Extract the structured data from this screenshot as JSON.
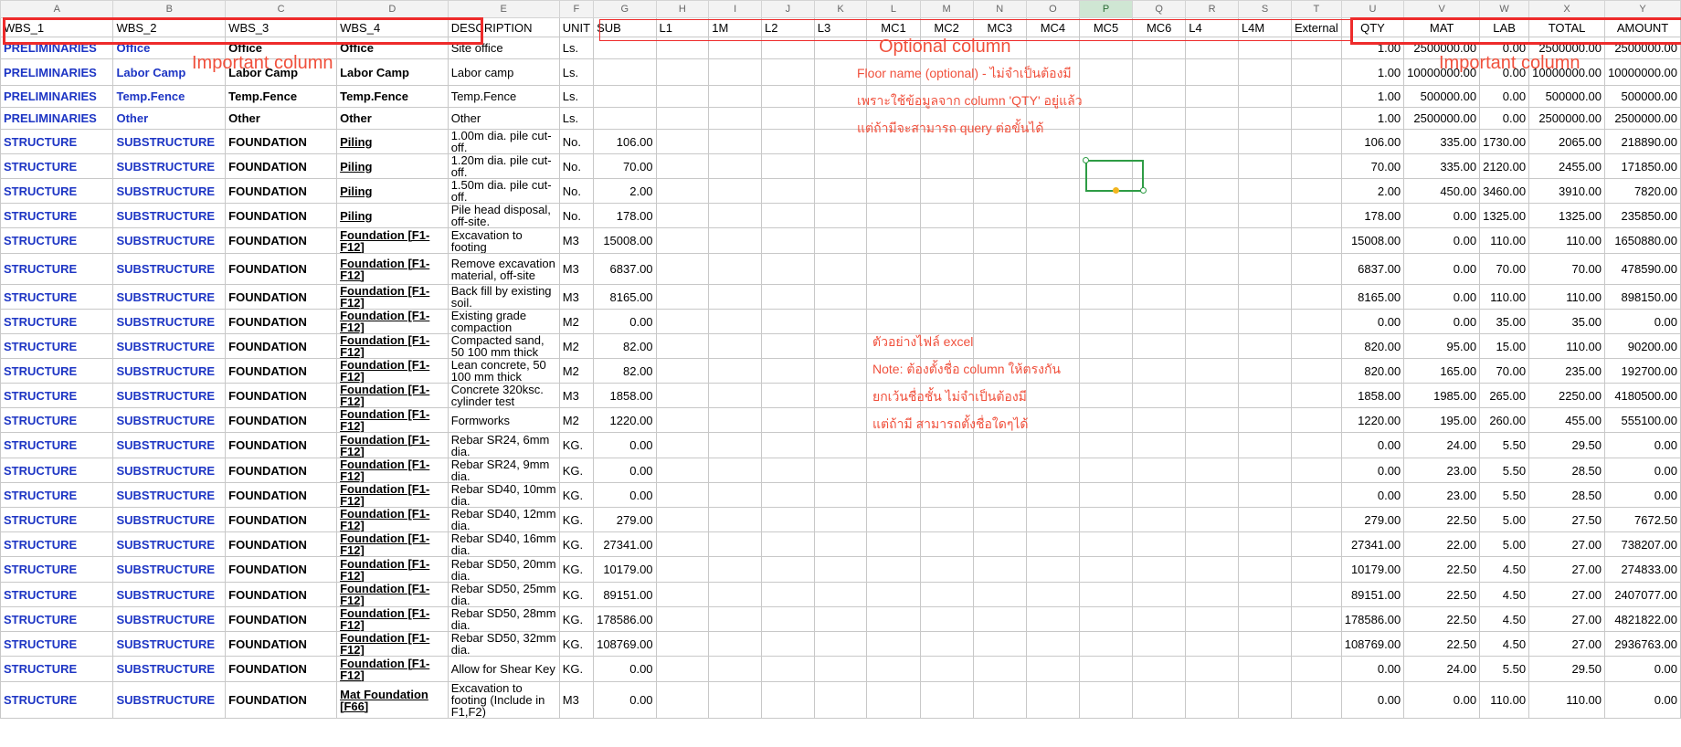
{
  "column_letters": [
    "A",
    "B",
    "C",
    "D",
    "E",
    "F",
    "G",
    "H",
    "I",
    "J",
    "K",
    "L",
    "M",
    "N",
    "O",
    "P",
    "Q",
    "R",
    "S",
    "T",
    "U",
    "V",
    "W",
    "X",
    "Y"
  ],
  "selected_column": "P",
  "header": [
    "WBS_1",
    "WBS_2",
    "WBS_3",
    "WBS_4",
    "DESCRIPTION",
    "UNIT",
    "SUB",
    "L1",
    "1M",
    "L2",
    "L3",
    "MC1",
    "MC2",
    "MC3",
    "MC4",
    "MC5",
    "MC6",
    "L4",
    "L4M",
    "External",
    "QTY",
    "MAT",
    "LAB",
    "TOTAL",
    "AMOUNT"
  ],
  "rows": [
    {
      "wbs1": "PRELIMINARIES",
      "wbs2": "Office",
      "wbs3": "Office",
      "wbs4": "Office",
      "desc": "Site office",
      "unit": "Ls.",
      "sub": "",
      "qty": "1.00",
      "mat": "2500000.00",
      "lab": "0.00",
      "total": "2500000.00",
      "amount": "2500000.00"
    },
    {
      "wbs1": "PRELIMINARIES",
      "wbs2": "Labor Camp",
      "wbs3": "Labor Camp",
      "wbs4": "Labor Camp",
      "desc": "Labor camp",
      "unit": "Ls.",
      "sub": "",
      "qty": "1.00",
      "mat": "10000000.00",
      "lab": "0.00",
      "total": "10000000.00",
      "amount": "10000000.00"
    },
    {
      "wbs1": "PRELIMINARIES",
      "wbs2": "Temp.Fence",
      "wbs3": "Temp.Fence",
      "wbs4": "Temp.Fence",
      "desc": "Temp.Fence",
      "unit": "Ls.",
      "sub": "",
      "qty": "1.00",
      "mat": "500000.00",
      "lab": "0.00",
      "total": "500000.00",
      "amount": "500000.00"
    },
    {
      "wbs1": "PRELIMINARIES",
      "wbs2": "Other",
      "wbs3": "Other",
      "wbs4": "Other",
      "desc": "Other",
      "unit": "Ls.",
      "sub": "",
      "qty": "1.00",
      "mat": "2500000.00",
      "lab": "0.00",
      "total": "2500000.00",
      "amount": "2500000.00"
    },
    {
      "wbs1": "STRUCTURE",
      "wbs2": "SUBSTRUCTURE",
      "wbs3": "FOUNDATION",
      "wbs4": "Piling",
      "desc": "1.00m dia. pile cut-off.",
      "unit": "No.",
      "sub": "106.00",
      "qty": "106.00",
      "mat": "335.00",
      "lab": "1730.00",
      "total": "2065.00",
      "amount": "218890.00"
    },
    {
      "wbs1": "STRUCTURE",
      "wbs2": "SUBSTRUCTURE",
      "wbs3": "FOUNDATION",
      "wbs4": "Piling",
      "desc": "1.20m dia. pile cut-off.",
      "unit": "No.",
      "sub": "70.00",
      "qty": "70.00",
      "mat": "335.00",
      "lab": "2120.00",
      "total": "2455.00",
      "amount": "171850.00"
    },
    {
      "wbs1": "STRUCTURE",
      "wbs2": "SUBSTRUCTURE",
      "wbs3": "FOUNDATION",
      "wbs4": "Piling",
      "desc": "1.50m dia. pile cut-off.",
      "unit": "No.",
      "sub": "2.00",
      "qty": "2.00",
      "mat": "450.00",
      "lab": "3460.00",
      "total": "3910.00",
      "amount": "7820.00"
    },
    {
      "wbs1": "STRUCTURE",
      "wbs2": "SUBSTRUCTURE",
      "wbs3": "FOUNDATION",
      "wbs4": "Piling",
      "desc": "Pile head disposal, off-site.",
      "unit": "No.",
      "sub": "178.00",
      "qty": "178.00",
      "mat": "0.00",
      "lab": "1325.00",
      "total": "1325.00",
      "amount": "235850.00"
    },
    {
      "wbs1": "STRUCTURE",
      "wbs2": "SUBSTRUCTURE",
      "wbs3": "FOUNDATION",
      "wbs4": "Foundation [F1-F12]",
      "desc": "Excavation to footing",
      "unit": "M3",
      "sub": "15008.00",
      "qty": "15008.00",
      "mat": "0.00",
      "lab": "110.00",
      "total": "110.00",
      "amount": "1650880.00"
    },
    {
      "wbs1": "STRUCTURE",
      "wbs2": "SUBSTRUCTURE",
      "wbs3": "FOUNDATION",
      "wbs4": "Foundation [F1-F12]",
      "desc": "Remove excavation material, off-site",
      "unit": "M3",
      "sub": "6837.00",
      "qty": "6837.00",
      "mat": "0.00",
      "lab": "70.00",
      "total": "70.00",
      "amount": "478590.00"
    },
    {
      "wbs1": "STRUCTURE",
      "wbs2": "SUBSTRUCTURE",
      "wbs3": "FOUNDATION",
      "wbs4": "Foundation [F1-F12]",
      "desc": "Back fill by existing soil.",
      "unit": "M3",
      "sub": "8165.00",
      "qty": "8165.00",
      "mat": "0.00",
      "lab": "110.00",
      "total": "110.00",
      "amount": "898150.00"
    },
    {
      "wbs1": "STRUCTURE",
      "wbs2": "SUBSTRUCTURE",
      "wbs3": "FOUNDATION",
      "wbs4": "Foundation [F1-F12]",
      "desc": "Existing grade compaction",
      "unit": "M2",
      "sub": "0.00",
      "qty": "0.00",
      "mat": "0.00",
      "lab": "35.00",
      "total": "35.00",
      "amount": "0.00"
    },
    {
      "wbs1": "STRUCTURE",
      "wbs2": "SUBSTRUCTURE",
      "wbs3": "FOUNDATION",
      "wbs4": "Foundation [F1-F12]",
      "desc": "Compacted sand, 50 100 mm thick",
      "unit": "M2",
      "sub": "82.00",
      "qty": "820.00",
      "mat": "95.00",
      "lab": "15.00",
      "total": "110.00",
      "amount": "90200.00"
    },
    {
      "wbs1": "STRUCTURE",
      "wbs2": "SUBSTRUCTURE",
      "wbs3": "FOUNDATION",
      "wbs4": "Foundation [F1-F12]",
      "desc": "Lean concrete, 50 100 mm thick",
      "unit": "M2",
      "sub": "82.00",
      "qty": "820.00",
      "mat": "165.00",
      "lab": "70.00",
      "total": "235.00",
      "amount": "192700.00"
    },
    {
      "wbs1": "STRUCTURE",
      "wbs2": "SUBSTRUCTURE",
      "wbs3": "FOUNDATION",
      "wbs4": "Foundation [F1-F12]",
      "desc": "Concrete 320ksc. cylinder test",
      "unit": "M3",
      "sub": "1858.00",
      "qty": "1858.00",
      "mat": "1985.00",
      "lab": "265.00",
      "total": "2250.00",
      "amount": "4180500.00"
    },
    {
      "wbs1": "STRUCTURE",
      "wbs2": "SUBSTRUCTURE",
      "wbs3": "FOUNDATION",
      "wbs4": "Foundation [F1-F12]",
      "desc": "Formworks",
      "unit": "M2",
      "sub": "1220.00",
      "qty": "1220.00",
      "mat": "195.00",
      "lab": "260.00",
      "total": "455.00",
      "amount": "555100.00"
    },
    {
      "wbs1": "STRUCTURE",
      "wbs2": "SUBSTRUCTURE",
      "wbs3": "FOUNDATION",
      "wbs4": "Foundation [F1-F12]",
      "desc": "Rebar SR24, 6mm dia.",
      "unit": "KG.",
      "sub": "0.00",
      "qty": "0.00",
      "mat": "24.00",
      "lab": "5.50",
      "total": "29.50",
      "amount": "0.00"
    },
    {
      "wbs1": "STRUCTURE",
      "wbs2": "SUBSTRUCTURE",
      "wbs3": "FOUNDATION",
      "wbs4": "Foundation [F1-F12]",
      "desc": "Rebar SR24, 9mm dia.",
      "unit": "KG.",
      "sub": "0.00",
      "qty": "0.00",
      "mat": "23.00",
      "lab": "5.50",
      "total": "28.50",
      "amount": "0.00"
    },
    {
      "wbs1": "STRUCTURE",
      "wbs2": "SUBSTRUCTURE",
      "wbs3": "FOUNDATION",
      "wbs4": "Foundation [F1-F12]",
      "desc": "Rebar SD40, 10mm dia.",
      "unit": "KG.",
      "sub": "0.00",
      "qty": "0.00",
      "mat": "23.00",
      "lab": "5.50",
      "total": "28.50",
      "amount": "0.00"
    },
    {
      "wbs1": "STRUCTURE",
      "wbs2": "SUBSTRUCTURE",
      "wbs3": "FOUNDATION",
      "wbs4": "Foundation [F1-F12]",
      "desc": "Rebar SD40, 12mm dia.",
      "unit": "KG.",
      "sub": "279.00",
      "qty": "279.00",
      "mat": "22.50",
      "lab": "5.00",
      "total": "27.50",
      "amount": "7672.50"
    },
    {
      "wbs1": "STRUCTURE",
      "wbs2": "SUBSTRUCTURE",
      "wbs3": "FOUNDATION",
      "wbs4": "Foundation [F1-F12]",
      "desc": "Rebar SD40, 16mm dia.",
      "unit": "KG.",
      "sub": "27341.00",
      "qty": "27341.00",
      "mat": "22.00",
      "lab": "5.00",
      "total": "27.00",
      "amount": "738207.00"
    },
    {
      "wbs1": "STRUCTURE",
      "wbs2": "SUBSTRUCTURE",
      "wbs3": "FOUNDATION",
      "wbs4": "Foundation [F1-F12]",
      "desc": "Rebar SD50, 20mm dia.",
      "unit": "KG.",
      "sub": "10179.00",
      "qty": "10179.00",
      "mat": "22.50",
      "lab": "4.50",
      "total": "27.00",
      "amount": "274833.00"
    },
    {
      "wbs1": "STRUCTURE",
      "wbs2": "SUBSTRUCTURE",
      "wbs3": "FOUNDATION",
      "wbs4": "Foundation [F1-F12]",
      "desc": "Rebar SD50, 25mm dia.",
      "unit": "KG.",
      "sub": "89151.00",
      "qty": "89151.00",
      "mat": "22.50",
      "lab": "4.50",
      "total": "27.00",
      "amount": "2407077.00"
    },
    {
      "wbs1": "STRUCTURE",
      "wbs2": "SUBSTRUCTURE",
      "wbs3": "FOUNDATION",
      "wbs4": "Foundation [F1-F12]",
      "desc": "Rebar SD50, 28mm dia.",
      "unit": "KG.",
      "sub": "178586.00",
      "qty": "178586.00",
      "mat": "22.50",
      "lab": "4.50",
      "total": "27.00",
      "amount": "4821822.00"
    },
    {
      "wbs1": "STRUCTURE",
      "wbs2": "SUBSTRUCTURE",
      "wbs3": "FOUNDATION",
      "wbs4": "Foundation [F1-F12]",
      "desc": "Rebar SD50, 32mm dia.",
      "unit": "KG.",
      "sub": "108769.00",
      "qty": "108769.00",
      "mat": "22.50",
      "lab": "4.50",
      "total": "27.00",
      "amount": "2936763.00"
    },
    {
      "wbs1": "STRUCTURE",
      "wbs2": "SUBSTRUCTURE",
      "wbs3": "FOUNDATION",
      "wbs4": "Foundation [F1-F12]",
      "desc": "Allow for Shear Key",
      "unit": "KG.",
      "sub": "0.00",
      "qty": "0.00",
      "mat": "24.00",
      "lab": "5.50",
      "total": "29.50",
      "amount": "0.00"
    },
    {
      "wbs1": "STRUCTURE",
      "wbs2": "SUBSTRUCTURE",
      "wbs3": "FOUNDATION",
      "wbs4": "Mat Foundation [F66]",
      "desc": "Excavation to footing (Include in F1,F2)",
      "unit": "M3",
      "sub": "0.00",
      "qty": "0.00",
      "mat": "0.00",
      "lab": "110.00",
      "total": "110.00",
      "amount": "0.00"
    }
  ],
  "annotations": {
    "important_left": "Important column",
    "optional": "Optional column",
    "important_right": "Important column",
    "floor_note": [
      "Floor name (optional) - ไม่จำเป็นต้องมี",
      "เพราะใช้ข้อมูลจาก column 'QTY' อยู่แล้ว",
      "แต่ถ้ามีจะสามารถ query ต่อขั้นได้"
    ],
    "example_note": [
      "ตัวอย่างไฟล์ excel",
      "Note: ต้องตั้งชื่อ column ให้ตรงกัน",
      "ยกเว้นชื่อชั้น ไม่จำเป็นต้องมี",
      "แต่ถ้ามี สามารถตั้งชื่อใดๆได้"
    ]
  },
  "colors": {
    "wbs_blue": "#1d35c4",
    "annotation_red": "#f0503c",
    "box_red": "#ee2b2b",
    "selection_green": "#2e9c45"
  }
}
